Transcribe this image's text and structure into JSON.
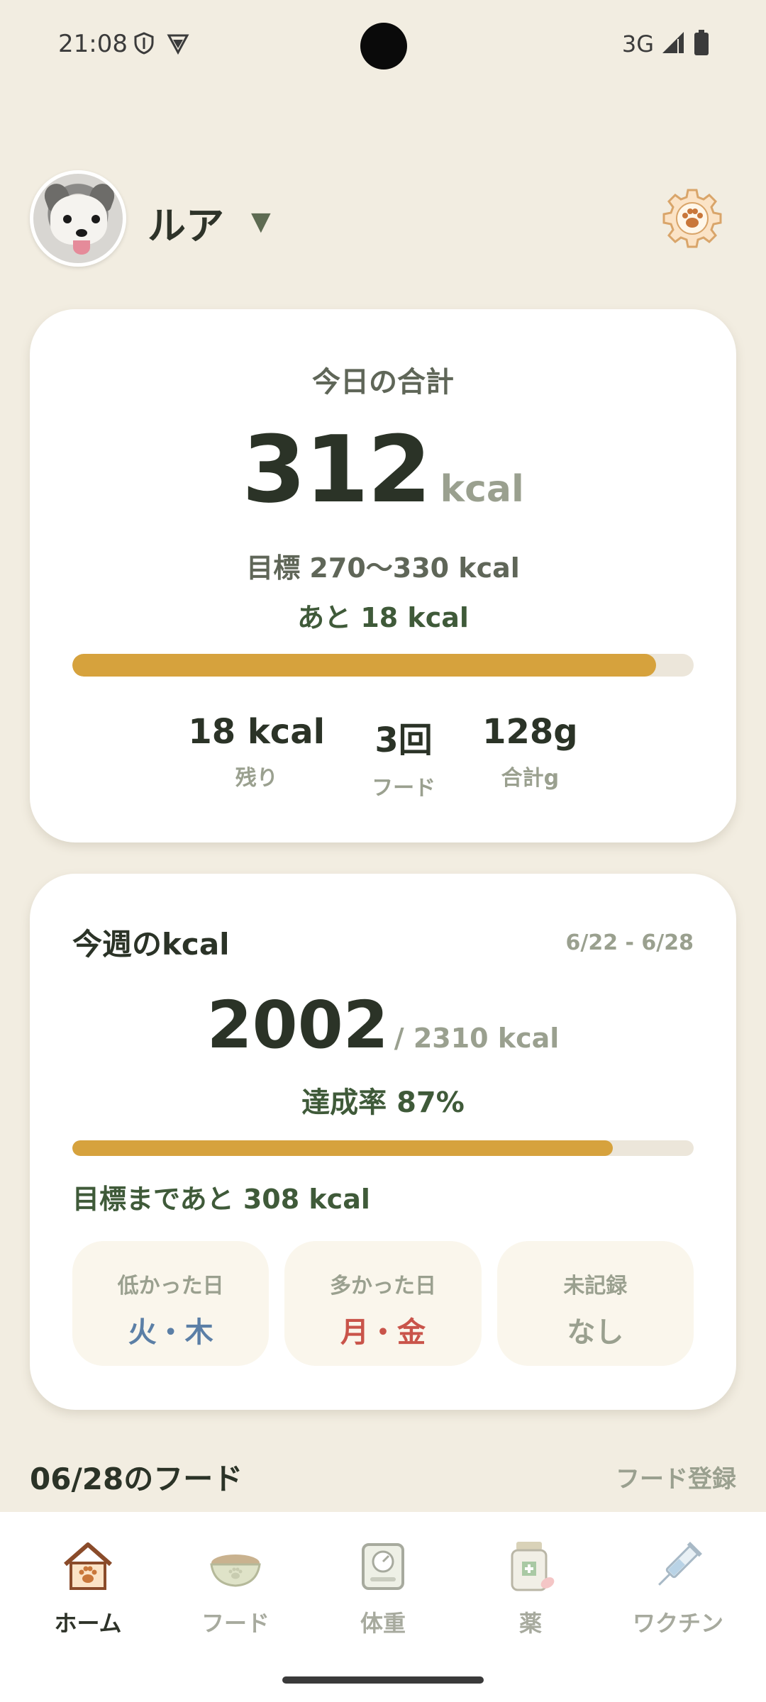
{
  "status_bar": {
    "time": "21:08",
    "network": "3G"
  },
  "header": {
    "pet_name": "ルア",
    "caret": "▼"
  },
  "today": {
    "title": "今日の合計",
    "total": "312",
    "unit": "kcal",
    "target": "目標 270〜330 kcal",
    "remaining": "あと 18 kcal",
    "progress": 0.94,
    "stats": [
      {
        "value": "18 kcal",
        "label": "残り"
      },
      {
        "value": "3回",
        "label": "フード"
      },
      {
        "value": "128g",
        "label": "合計g"
      }
    ]
  },
  "week": {
    "title": "今週のkcal",
    "range": "6/22 - 6/28",
    "total": "2002",
    "goal": "/ 2310 kcal",
    "achievement": "達成率 87%",
    "progress": 0.87,
    "to_goal": "目標まであと 308 kcal",
    "boxes": [
      {
        "label": "低かった日",
        "value": "火・木",
        "color": "#5b7fa6"
      },
      {
        "label": "多かった日",
        "value": "月・金",
        "color": "#c9544a"
      },
      {
        "label": "未記録",
        "value": "なし",
        "color": "#9aa08f"
      }
    ]
  },
  "food_section": {
    "title": "06/28のフード",
    "register": "フード登録"
  },
  "nav": [
    {
      "label": "ホーム",
      "icon": "house-paw-icon",
      "active": true
    },
    {
      "label": "フード",
      "icon": "food-bowl-icon",
      "active": false
    },
    {
      "label": "体重",
      "icon": "scale-icon",
      "active": false
    },
    {
      "label": "薬",
      "icon": "medicine-bottle-icon",
      "active": false
    },
    {
      "label": "ワクチン",
      "icon": "syringe-icon",
      "active": false
    }
  ],
  "colors": {
    "background": "#f2ede1",
    "accent": "#d6a23d",
    "green_text": "#3f5a39"
  }
}
